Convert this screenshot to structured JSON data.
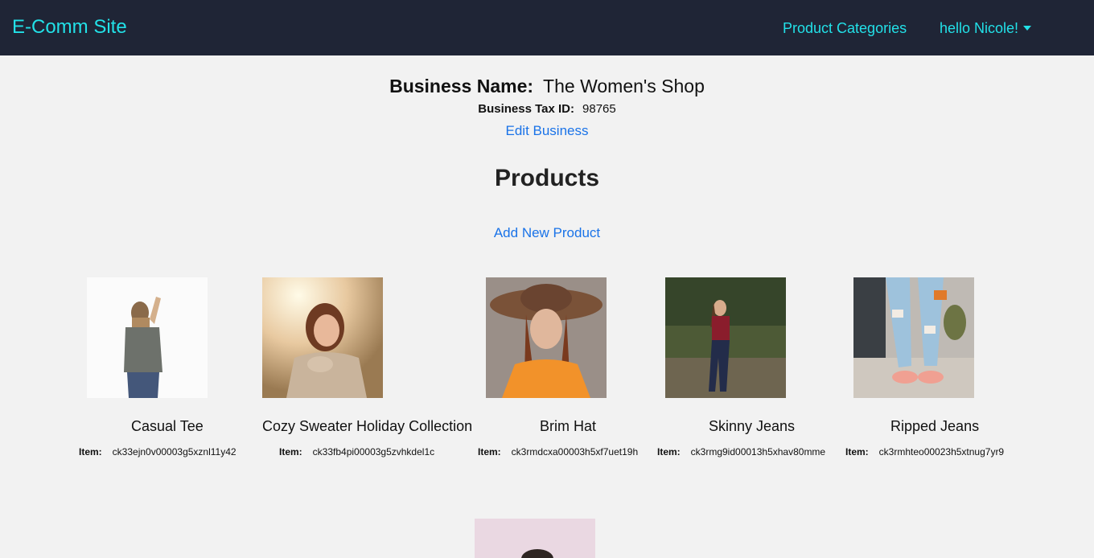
{
  "navbar": {
    "brand": "E-Comm Site",
    "categories_link": "Product Categories",
    "user_greeting": "hello Nicole!"
  },
  "business": {
    "name_label": "Business Name:",
    "name_value": "The Women's Shop",
    "tax_label": "Business Tax ID:",
    "tax_value": "98765",
    "edit_link": "Edit Business"
  },
  "products": {
    "heading": "Products",
    "add_link": "Add New Product",
    "item_label": "Item:",
    "items": [
      {
        "name": "Casual Tee",
        "id": "ck33ejn0v00003g5xznl11y42"
      },
      {
        "name": "Cozy Sweater Holiday Collection",
        "id": "ck33fb4pi00003g5zvhkdel1c"
      },
      {
        "name": "Brim Hat",
        "id": "ck3rmdcxa00003h5xf7uet19h"
      },
      {
        "name": "Skinny Jeans",
        "id": "ck3rmg9id00013h5xhav80mme"
      },
      {
        "name": "Ripped Jeans",
        "id": "ck3rmhteo00023h5xtnug7yr9"
      }
    ]
  },
  "colors": {
    "navbar_bg": "#1f2536",
    "nav_text": "#22e1e8",
    "link": "#1a73e8",
    "page_bg": "#f2f2f2"
  }
}
